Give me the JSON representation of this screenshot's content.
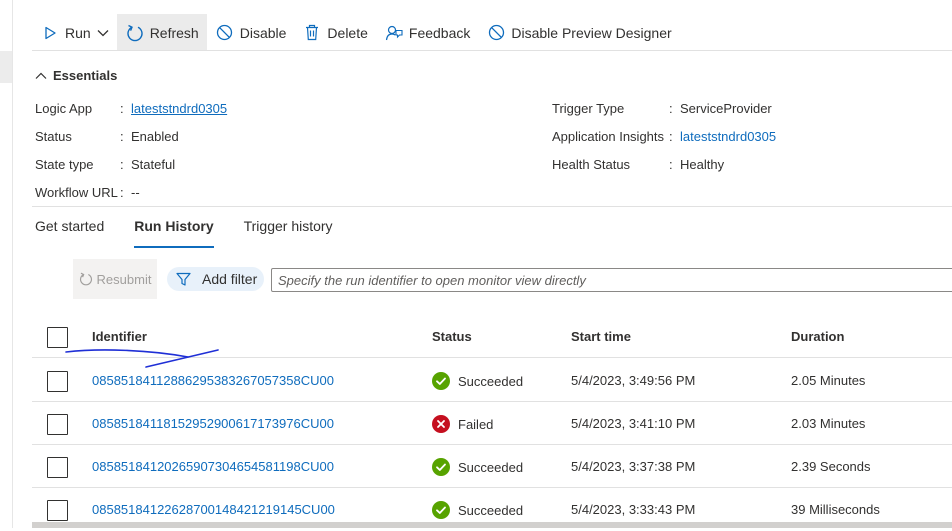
{
  "toolbar": {
    "run_label": "Run",
    "refresh_label": "Refresh",
    "disable_label": "Disable",
    "delete_label": "Delete",
    "feedback_label": "Feedback",
    "disable_preview_label": "Disable Preview Designer"
  },
  "essentials": {
    "title": "Essentials",
    "logic_app": {
      "label": "Logic App",
      "value": "lateststndrd0305"
    },
    "status": {
      "label": "Status",
      "value": "Enabled"
    },
    "state_type": {
      "label": "State type",
      "value": "Stateful"
    },
    "workflow_url": {
      "label": "Workflow URL",
      "value": "--"
    },
    "trigger_type": {
      "label": "Trigger Type",
      "value": "ServiceProvider"
    },
    "app_insights": {
      "label": "Application Insights",
      "value": "lateststndrd0305"
    },
    "health_status": {
      "label": "Health Status",
      "value": "Healthy"
    },
    "separator": ":"
  },
  "tabs": [
    {
      "label": "Get started",
      "active": false
    },
    {
      "label": "Run History",
      "active": true
    },
    {
      "label": "Trigger history",
      "active": false
    }
  ],
  "filters": {
    "resubmit_label": "Resubmit",
    "add_filter_label": "Add filter",
    "search_placeholder": "Specify the run identifier to open monitor view directly"
  },
  "table": {
    "columns": [
      "Identifier",
      "Status",
      "Start time",
      "Duration"
    ],
    "rows": [
      {
        "id": "08585184112886295383267057358CU00",
        "status": "Succeeded",
        "start": "5/4/2023, 3:49:56 PM",
        "duration": "2.05 Minutes"
      },
      {
        "id": "08585184118152952900617173976CU00",
        "status": "Failed",
        "start": "5/4/2023, 3:41:10 PM",
        "duration": "2.03 Minutes"
      },
      {
        "id": "08585184120265907304654581198CU00",
        "status": "Succeeded",
        "start": "5/4/2023, 3:37:38 PM",
        "duration": "2.39 Seconds"
      },
      {
        "id": "08585184122628700148421219145CU00",
        "status": "Succeeded",
        "start": "5/4/2023, 3:33:43 PM",
        "duration": "39 Milliseconds"
      }
    ]
  },
  "colors": {
    "accent": "#0f6cbd",
    "success": "#57a300",
    "failed": "#c50f1f",
    "annotation": "#1f2fd6"
  },
  "icons": {
    "run": "play-icon",
    "refresh": "refresh-icon",
    "disable": "disable-icon",
    "delete": "trash-icon",
    "feedback": "feedback-icon",
    "disable_preview": "disable-icon",
    "filter": "filter-icon",
    "resubmit": "refresh-icon",
    "succeeded": "check-circle-icon",
    "failed": "error-circle-icon"
  }
}
